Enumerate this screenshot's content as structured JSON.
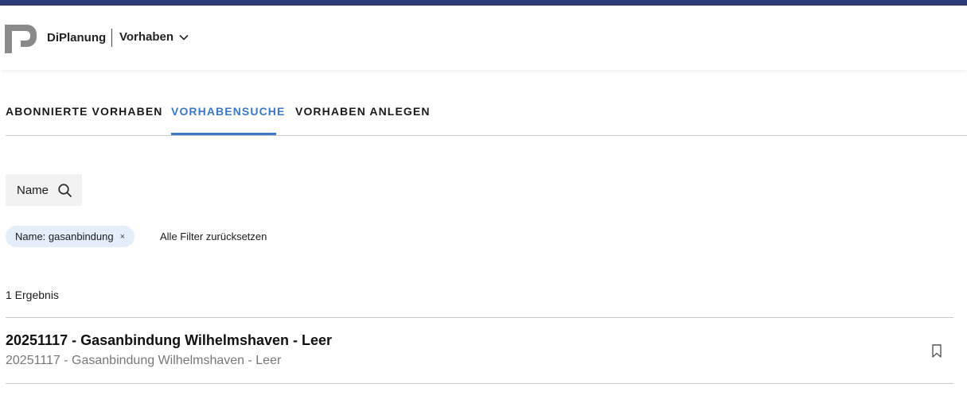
{
  "header": {
    "brand": "DiPlanung",
    "project_menu_label": "Vorhaben",
    "icons": {
      "logo": "diplanung-logo",
      "menu": "chevron-down-icon"
    }
  },
  "tabs": [
    {
      "label": "ABONNIERTE VORHABEN",
      "active": false
    },
    {
      "label": "VORHABENSUCHE",
      "active": true
    },
    {
      "label": "VORHABEN ANLEGEN",
      "active": false
    }
  ],
  "colors": {
    "accent": "#3c78c3",
    "topbar": "#2f3a78",
    "chip_bg": "#e4eefb"
  },
  "search": {
    "button_label": "Name",
    "icon": "search-icon"
  },
  "filters": {
    "active": [
      {
        "label": "Name: gasanbindung",
        "remove_symbol": "×"
      }
    ],
    "reset_label": "Alle Filter zurücksetzen"
  },
  "results": {
    "count_label": "1 Ergebnis",
    "items": [
      {
        "title": "20251117 - Gasanbindung Wilhelmshaven - Leer",
        "subtitle": "20251117 - Gasanbindung Wilhelmshaven - Leer",
        "icon": "bookmark-icon"
      }
    ]
  }
}
